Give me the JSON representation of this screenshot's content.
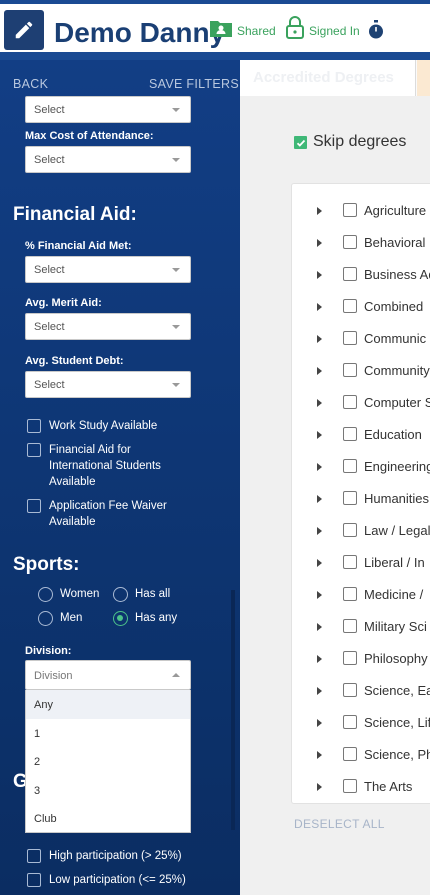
{
  "header": {
    "title": "Demo Danny",
    "shared_label": "Shared",
    "signed_in_label": "Signed In",
    "icon_color": "#3aa25d"
  },
  "sidebar": {
    "back_label": "BACK",
    "save_filters_label": "SAVE FILTERS",
    "top_select_value": "Select",
    "max_cost_label": "Max Cost of Attendance:",
    "max_cost_value": "Select",
    "financial_aid_title": "Financial Aid:",
    "fa_met_label": "% Financial Aid Met:",
    "fa_met_value": "Select",
    "merit_aid_label": "Avg. Merit Aid:",
    "merit_aid_value": "Select",
    "student_debt_label": "Avg. Student Debt:",
    "student_debt_value": "Select",
    "checkboxes": [
      "Work Study Available",
      "Financial Aid for International Students Available",
      "Application Fee Waiver Available"
    ],
    "sports_title": "Sports:",
    "radios": {
      "women": "Women",
      "men": "Men",
      "has_all": "Has all",
      "has_any": "Has any",
      "selected": "Has any"
    },
    "division_label": "Division:",
    "division_placeholder": "Division",
    "division_options": [
      "Any",
      "1",
      "2",
      "3",
      "Club"
    ],
    "next_section_partial": "G",
    "participation": [
      "High participation (> 25%)",
      "Low participation (<= 25%)"
    ]
  },
  "main": {
    "tab_label": "Accredited Degrees",
    "skip_label": "Skip degrees",
    "degrees": [
      "Agriculture",
      "Behavioral",
      "Business Ad",
      "Combined",
      "Communic",
      "Community",
      "Computer S",
      "Education",
      "Engineering",
      "Humanities",
      "Law / Legal",
      "Liberal / In",
      "Medicine /",
      "Military Sci",
      "Philosophy",
      "Science, Ea",
      "Science, Lif",
      "Science, Ph",
      "The Arts"
    ],
    "deselect_all": "DESELECT ALL"
  }
}
